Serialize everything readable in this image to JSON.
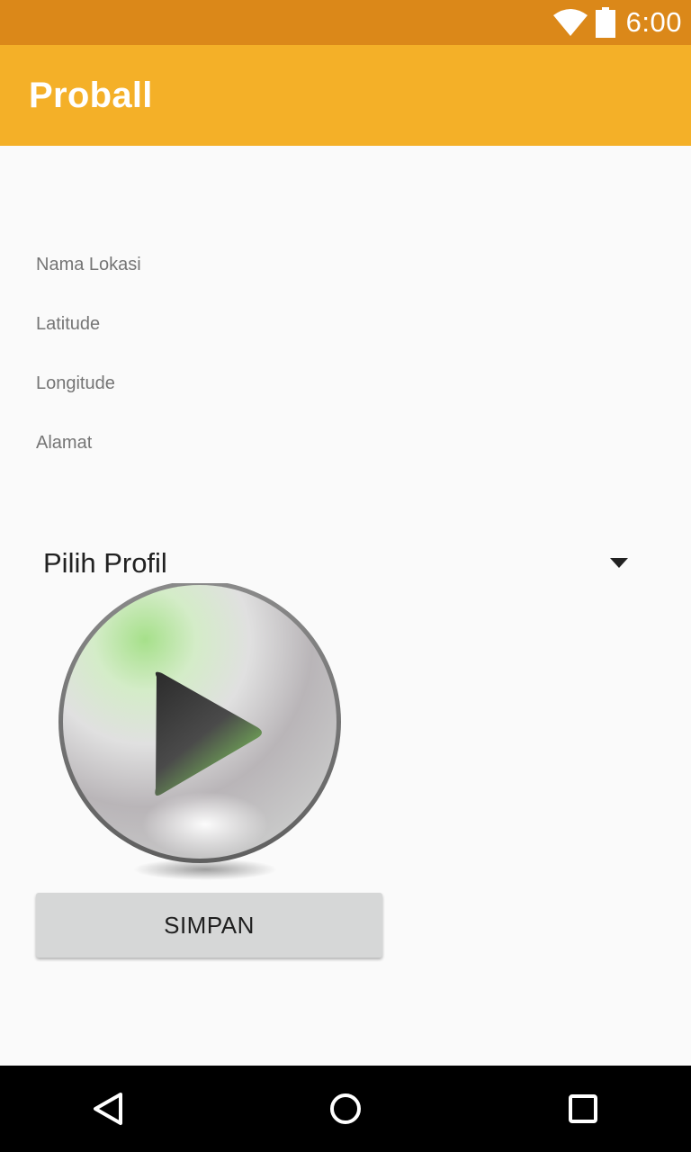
{
  "status_bar": {
    "time": "6:00",
    "icons": [
      "wifi-icon",
      "battery-icon"
    ],
    "color": "#db8819"
  },
  "app_bar": {
    "title": "Proball",
    "color": "#f4b028"
  },
  "form": {
    "nama_lokasi_placeholder": "Nama Lokasi",
    "latitude_placeholder": "Latitude",
    "longitude_placeholder": "Longitude",
    "alamat_placeholder": "Alamat"
  },
  "spinner": {
    "selected": "Pilih Profil",
    "icon": "dropdown-arrow-icon"
  },
  "image": {
    "icon": "play-icon",
    "accent": "#8fd86a"
  },
  "save_button": {
    "label": "SIMPAN"
  },
  "nav_bar": {
    "buttons": [
      "back-icon",
      "home-icon",
      "recents-icon"
    ]
  }
}
